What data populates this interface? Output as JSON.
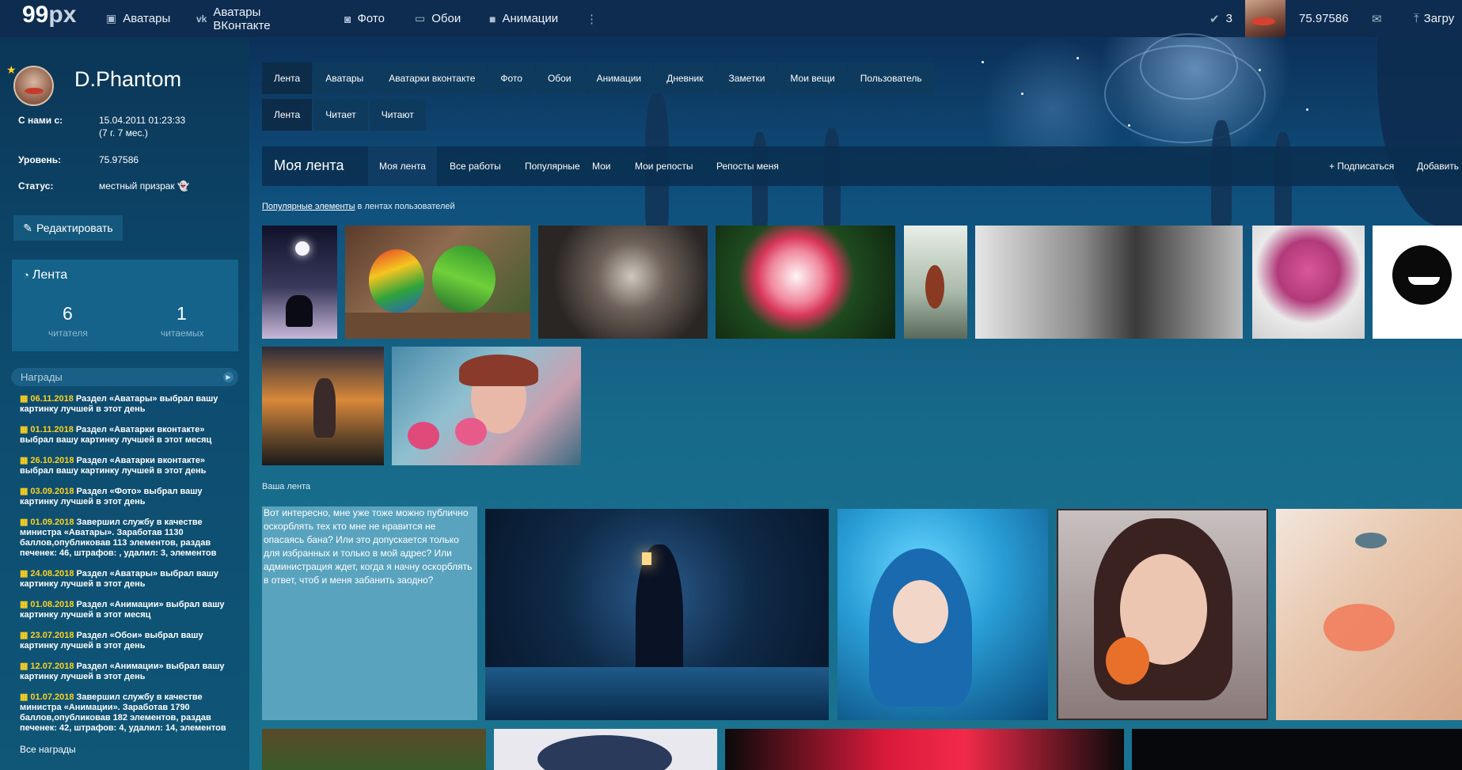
{
  "site": {
    "logo_main": "99",
    "logo_px": "px"
  },
  "topnav": [
    {
      "label": "Аватары",
      "icon": "image-icon"
    },
    {
      "label": "Аватары ВКонтакте",
      "icon": "vk-icon"
    },
    {
      "label": "Фото",
      "icon": "camera-icon"
    },
    {
      "label": "Обои",
      "icon": "monitor-icon"
    },
    {
      "label": "Анимации",
      "icon": "video-icon"
    }
  ],
  "topright": {
    "checks": "3",
    "points": "75.97586",
    "upload": "Загру"
  },
  "profile": {
    "name": "D.Phantom",
    "since_label": "С нами с:",
    "since_value": "15.04.2011 01:23:33",
    "since_sub": "(7 г. 7 мес.)",
    "level_label": "Уровень:",
    "level_value": "75.97586",
    "status_label": "Статус:",
    "status_value": "местный призрак"
  },
  "edit_label": "Редактировать",
  "feedbox": {
    "title": "Лента",
    "readers_count": "6",
    "readers_label": "читателя",
    "reading_count": "1",
    "reading_label": "читаемых"
  },
  "awards": {
    "title": "Награды",
    "all_label": "Все награды",
    "items": [
      {
        "date": "06.11.2018",
        "text": "Раздел «Аватары» выбрал вашу картинку лучшей в этот день"
      },
      {
        "date": "01.11.2018",
        "text": "Раздел «Аватарки вконтакте» выбрал вашу картинку лучшей в этот месяц"
      },
      {
        "date": "26.10.2018",
        "text": "Раздел «Аватарки вконтакте» выбрал вашу картинку лучшей в этот день"
      },
      {
        "date": "03.09.2018",
        "text": "Раздел «Фото» выбрал вашу картинку лучшей в этот день"
      },
      {
        "date": "01.09.2018",
        "text": "Завершил службу в качестве министра «Аватары». Заработав 1130 баллов,опубликовав 113 элементов, раздав печенек: 46, штрафов: , удалил: 3, элементов"
      },
      {
        "date": "24.08.2018",
        "text": "Раздел «Аватары» выбрал вашу картинку лучшей в этот день"
      },
      {
        "date": "01.08.2018",
        "text": "Раздел «Анимации» выбрал вашу картинку лучшей в этот месяц"
      },
      {
        "date": "23.07.2018",
        "text": "Раздел «Обои» выбрал вашу картинку лучшей в этот день"
      },
      {
        "date": "12.07.2018",
        "text": "Раздел «Анимации» выбрал вашу картинку лучшей в этот день"
      },
      {
        "date": "01.07.2018",
        "text": "Завершил службу в качестве министра «Анимации». Заработав 1790 баллов,опубликовав 182 элементов, раздав печенек: 42, штрафов: 4, удалил: 14, элементов"
      }
    ]
  },
  "tabs_main": [
    "Лента",
    "Аватары",
    "Аватарки вконтакте",
    "Фото",
    "Обои",
    "Анимации",
    "Дневник",
    "Заметки",
    "Мои вещи",
    "Пользователь"
  ],
  "tabs_sub": [
    "Лента",
    "Читает",
    "Читают"
  ],
  "feedbar": {
    "title": "Моя лента",
    "tabs": [
      "Моя лента",
      "Все работы",
      "Популярные",
      "Мои",
      "Мои репосты",
      "Репосты меня"
    ],
    "subscribe": "+ Подписаться",
    "add": "Добавить"
  },
  "popular": {
    "link": "Популярные элементы",
    "rest": " в лентах пользователей"
  },
  "your_feed_label": "Ваша лента",
  "comment": "Вот интересно, мне уже тоже можно публично оскорблять тех кто мне не нравится не опасаясь бана? Или это допускается только для избранных и только в мой адрес? Или администрация ждет, когда я начну оскорблять в ответ, чтоб и меня забанить заодно?",
  "colors": {
    "topbar": "#0d2c4f",
    "accent_yellow": "#ffd21f",
    "tab_bg": "#0e3a5e"
  }
}
